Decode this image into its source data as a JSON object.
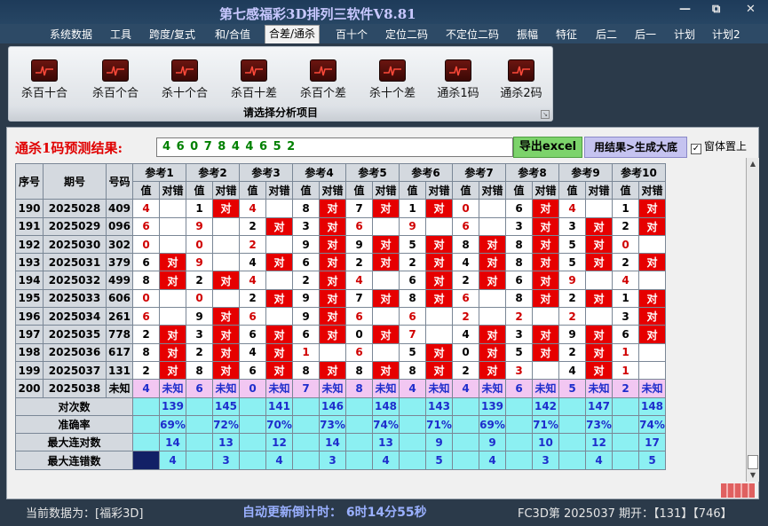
{
  "window": {
    "title": "第七感福彩3D排列三软件V8.81",
    "minimize": "—",
    "restore": "⧉",
    "close": "✕"
  },
  "menu": [
    "系统数据",
    "工具",
    "跨度/复式",
    "和/合值",
    "合差/通杀",
    "百十个",
    "定位二码",
    "不定位二码",
    "振幅",
    "特征",
    "后二",
    "后一",
    "计划",
    "计划2"
  ],
  "ribbon": {
    "buttons": [
      "杀百十合",
      "杀百个合",
      "杀十个合",
      "杀百十差",
      "杀百个差",
      "杀十个差",
      "通杀1码",
      "通杀2码"
    ],
    "footer": "请选择分析项目"
  },
  "prediction": {
    "label": "通杀1码预测结果:",
    "value": "4 6 0 7 8 4 4 6 5 2",
    "export_button": "导出excel",
    "generate_button": "用结果>生成大底",
    "topmost_checkbox": "窗体置上",
    "topmost_checked": "✓"
  },
  "table": {
    "headers": {
      "seq": "序号",
      "period": "期号",
      "number": "号码",
      "value": "值",
      "result": "对错"
    },
    "refs": [
      "参考1",
      "参考2",
      "参考3",
      "参考4",
      "参考5",
      "参考6",
      "参考7",
      "参考8",
      "参考9",
      "参考10"
    ],
    "rows": [
      {
        "seq": "190",
        "period": "2025028",
        "number": "409",
        "cells": [
          [
            "4",
            0
          ],
          [
            "1",
            1
          ],
          [
            "4",
            0
          ],
          [
            "8",
            1
          ],
          [
            "7",
            1
          ],
          [
            "1",
            1
          ],
          [
            "0",
            0
          ],
          [
            "6",
            1
          ],
          [
            "4",
            0
          ],
          [
            "1",
            1
          ]
        ]
      },
      {
        "seq": "191",
        "period": "2025029",
        "number": "096",
        "cells": [
          [
            "6",
            0
          ],
          [
            "9",
            0
          ],
          [
            "2",
            1
          ],
          [
            "3",
            1
          ],
          [
            "6",
            0
          ],
          [
            "9",
            0
          ],
          [
            "6",
            0
          ],
          [
            "3",
            1
          ],
          [
            "3",
            1
          ],
          [
            "2",
            1
          ]
        ]
      },
      {
        "seq": "192",
        "period": "2025030",
        "number": "302",
        "cells": [
          [
            "0",
            0
          ],
          [
            "0",
            0
          ],
          [
            "2",
            0
          ],
          [
            "9",
            1
          ],
          [
            "9",
            1
          ],
          [
            "5",
            1
          ],
          [
            "8",
            1
          ],
          [
            "8",
            1
          ],
          [
            "5",
            1
          ],
          [
            "0",
            0
          ]
        ]
      },
      {
        "seq": "193",
        "period": "2025031",
        "number": "379",
        "cells": [
          [
            "6",
            1
          ],
          [
            "9",
            0
          ],
          [
            "4",
            1
          ],
          [
            "6",
            1
          ],
          [
            "2",
            1
          ],
          [
            "2",
            1
          ],
          [
            "4",
            1
          ],
          [
            "8",
            1
          ],
          [
            "5",
            1
          ],
          [
            "2",
            1
          ]
        ]
      },
      {
        "seq": "194",
        "period": "2025032",
        "number": "499",
        "cells": [
          [
            "8",
            1
          ],
          [
            "2",
            1
          ],
          [
            "4",
            0
          ],
          [
            "2",
            1
          ],
          [
            "4",
            0
          ],
          [
            "6",
            1
          ],
          [
            "2",
            1
          ],
          [
            "6",
            1
          ],
          [
            "9",
            0
          ],
          [
            "4",
            0
          ]
        ]
      },
      {
        "seq": "195",
        "period": "2025033",
        "number": "606",
        "cells": [
          [
            "0",
            0
          ],
          [
            "0",
            0
          ],
          [
            "2",
            1
          ],
          [
            "9",
            1
          ],
          [
            "7",
            1
          ],
          [
            "8",
            1
          ],
          [
            "6",
            0
          ],
          [
            "8",
            1
          ],
          [
            "2",
            1
          ],
          [
            "1",
            1
          ]
        ]
      },
      {
        "seq": "196",
        "period": "2025034",
        "number": "261",
        "cells": [
          [
            "6",
            0
          ],
          [
            "9",
            1
          ],
          [
            "6",
            0
          ],
          [
            "9",
            1
          ],
          [
            "6",
            0
          ],
          [
            "6",
            0
          ],
          [
            "2",
            0
          ],
          [
            "2",
            0
          ],
          [
            "2",
            0
          ],
          [
            "3",
            1
          ]
        ]
      },
      {
        "seq": "197",
        "period": "2025035",
        "number": "778",
        "cells": [
          [
            "2",
            1
          ],
          [
            "3",
            1
          ],
          [
            "6",
            1
          ],
          [
            "6",
            1
          ],
          [
            "0",
            1
          ],
          [
            "7",
            0
          ],
          [
            "4",
            1
          ],
          [
            "3",
            1
          ],
          [
            "9",
            1
          ],
          [
            "6",
            1
          ]
        ]
      },
      {
        "seq": "198",
        "period": "2025036",
        "number": "617",
        "cells": [
          [
            "8",
            1
          ],
          [
            "2",
            1
          ],
          [
            "4",
            1
          ],
          [
            "1",
            0
          ],
          [
            "6",
            0
          ],
          [
            "5",
            1
          ],
          [
            "0",
            1
          ],
          [
            "5",
            1
          ],
          [
            "2",
            1
          ],
          [
            "1",
            0
          ]
        ]
      },
      {
        "seq": "199",
        "period": "2025037",
        "number": "131",
        "cells": [
          [
            "2",
            1
          ],
          [
            "8",
            1
          ],
          [
            "6",
            1
          ],
          [
            "8",
            1
          ],
          [
            "8",
            1
          ],
          [
            "8",
            1
          ],
          [
            "2",
            1
          ],
          [
            "3",
            0
          ],
          [
            "4",
            1
          ],
          [
            "1",
            0
          ]
        ]
      }
    ],
    "hit_label": "对",
    "pending": {
      "seq": "200",
      "period": "2025038",
      "number": "未知",
      "values": [
        "4",
        "6",
        "0",
        "7",
        "8",
        "4",
        "4",
        "6",
        "5",
        "2"
      ],
      "status": "未知"
    },
    "stats": [
      {
        "label": "对次数",
        "values": [
          "139",
          "145",
          "141",
          "146",
          "148",
          "143",
          "139",
          "142",
          "147",
          "148"
        ]
      },
      {
        "label": "准确率",
        "values": [
          "69%",
          "72%",
          "70%",
          "73%",
          "74%",
          "71%",
          "69%",
          "71%",
          "73%",
          "74%"
        ]
      },
      {
        "label": "最大连对数",
        "values": [
          "14",
          "13",
          "12",
          "14",
          "13",
          "9",
          "9",
          "10",
          "12",
          "17"
        ]
      },
      {
        "label": "最大连错数",
        "values": [
          "4",
          "3",
          "4",
          "3",
          "4",
          "5",
          "4",
          "3",
          "4",
          "5"
        ]
      }
    ]
  },
  "statusbar": {
    "current_data": "当前数据为：[福彩3D]",
    "countdown": "自动更新倒计时：  6时14分55秒",
    "latest": "FC3D第 2025037 期开：【131】【746】"
  },
  "colors": {
    "hit": "#e60000",
    "pending": "#f2c7f2",
    "stats": "#8cf0f2",
    "title": "#c8c8ff"
  }
}
